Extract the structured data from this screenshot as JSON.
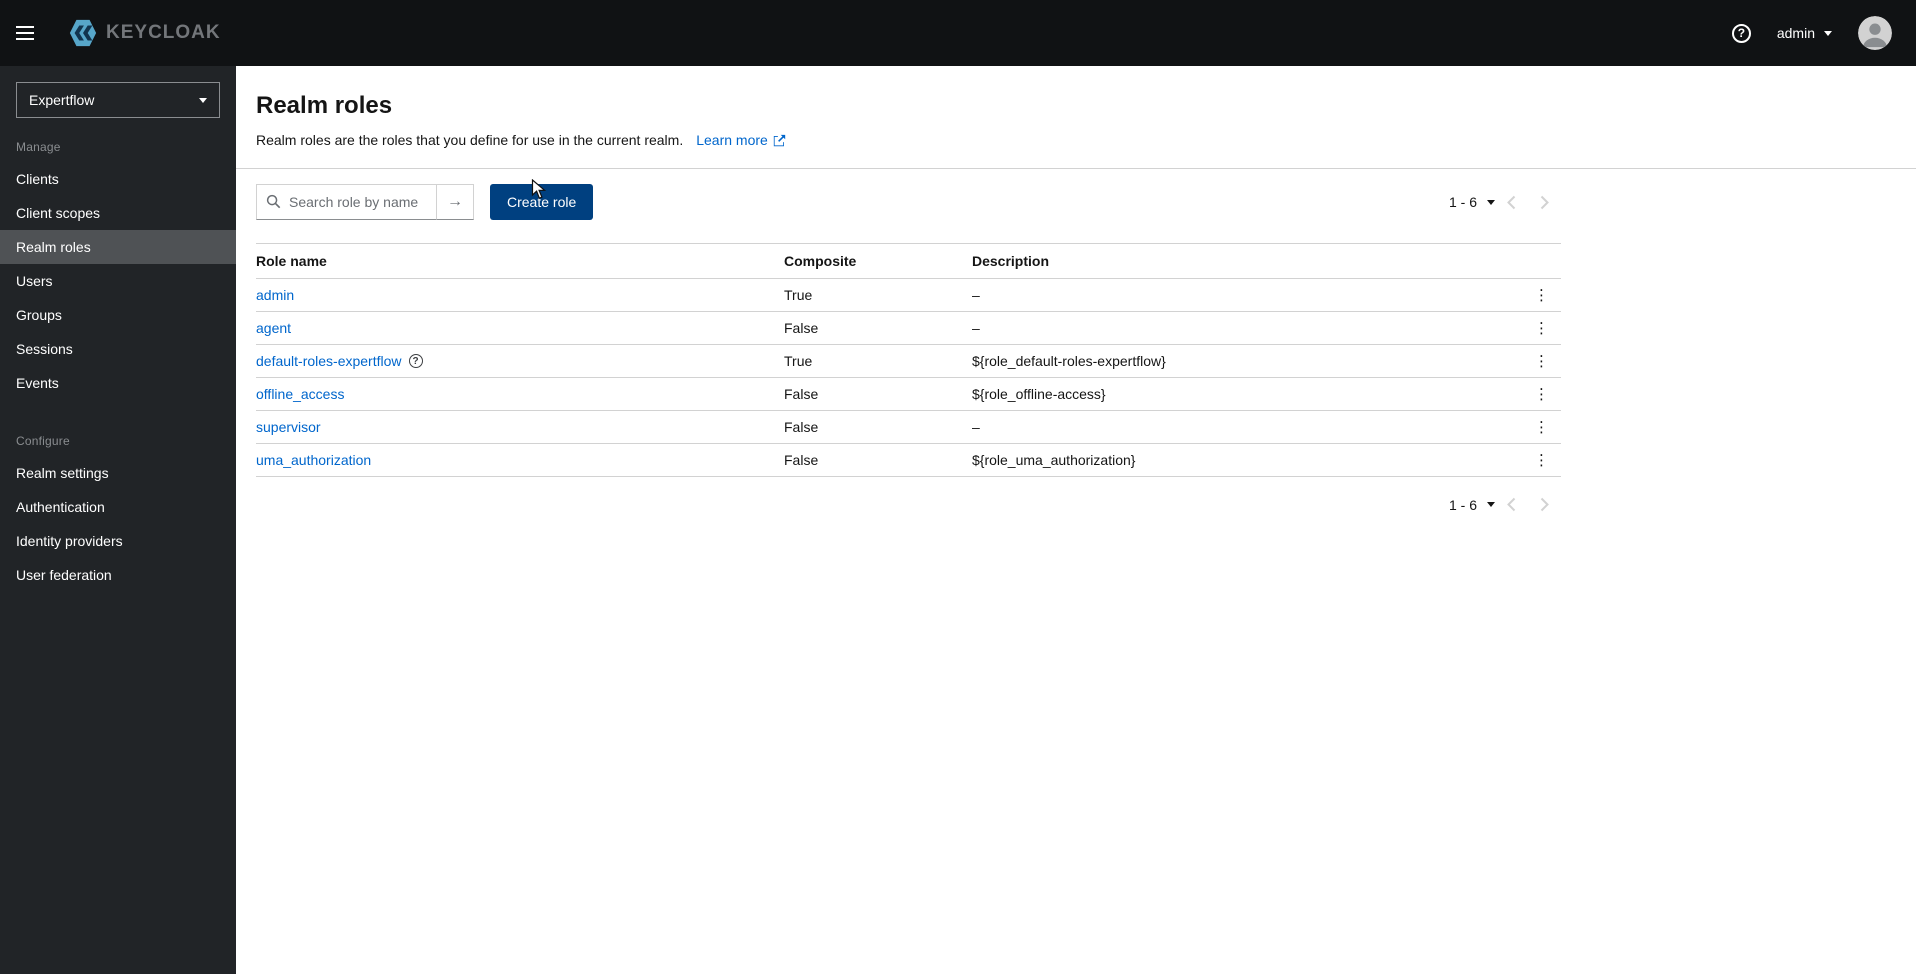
{
  "topbar": {
    "brand_text": "KEYCLOAK",
    "user_menu": {
      "label": "admin"
    }
  },
  "sidebar": {
    "realm_selector": {
      "value": "Expertflow"
    },
    "sections": [
      {
        "label": "Manage",
        "items": [
          {
            "label": "Clients"
          },
          {
            "label": "Client scopes"
          },
          {
            "label": "Realm roles"
          },
          {
            "label": "Users"
          },
          {
            "label": "Groups"
          },
          {
            "label": "Sessions"
          },
          {
            "label": "Events"
          }
        ]
      },
      {
        "label": "Configure",
        "items": [
          {
            "label": "Realm settings"
          },
          {
            "label": "Authentication"
          },
          {
            "label": "Identity providers"
          },
          {
            "label": "User federation"
          }
        ]
      }
    ]
  },
  "page": {
    "title": "Realm roles",
    "subtitle": "Realm roles are the roles that you define for use in the current realm.",
    "learn_more": "Learn more"
  },
  "toolbar": {
    "search_placeholder": "Search role by name",
    "create_button": "Create role"
  },
  "pagination": {
    "range": "1 - 6"
  },
  "table": {
    "columns": [
      "Role name",
      "Composite",
      "Description"
    ],
    "rows": [
      {
        "name": "admin",
        "composite": "True",
        "description": "–"
      },
      {
        "name": "agent",
        "composite": "False",
        "description": "–"
      },
      {
        "name": "default-roles-expertflow",
        "composite": "True",
        "description": "${role_default-roles-expertflow}"
      },
      {
        "name": "offline_access",
        "composite": "False",
        "description": "${role_offline-access}"
      },
      {
        "name": "supervisor",
        "composite": "False",
        "description": "–"
      },
      {
        "name": "uma_authorization",
        "composite": "False",
        "description": "${role_uma_authorization}"
      }
    ]
  },
  "colors": {
    "link": "#0066cc",
    "primary_button": "#004080",
    "topbar_bg": "#101214",
    "sidebar_bg": "#212427",
    "nav_active_bg": "#4f5255",
    "border": "#d2d2d2",
    "text": "#151515"
  }
}
